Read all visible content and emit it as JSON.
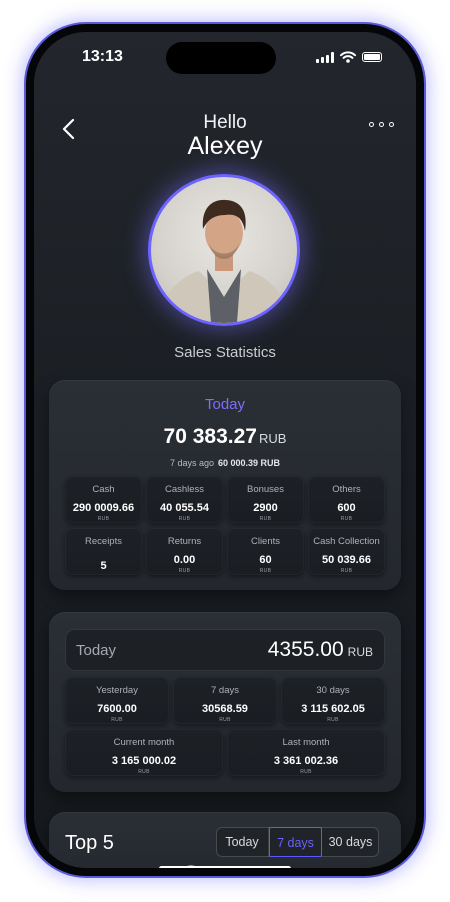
{
  "status_bar": {
    "time": "13:13"
  },
  "header": {
    "greeting": "Hello",
    "name": "Alexey"
  },
  "section_title": "Sales Statistics",
  "today_card": {
    "label": "Today",
    "total_value": "70 383.27",
    "total_currency": "RUB",
    "ago_label": "7 days ago",
    "ago_value": "60 000.39 RUB",
    "tiles": [
      {
        "label": "Cash",
        "value": "290 0009.66",
        "unit": "RUB"
      },
      {
        "label": "Cashless",
        "value": "40 055.54",
        "unit": "RUB"
      },
      {
        "label": "Bonuses",
        "value": "2900",
        "unit": "RUB"
      },
      {
        "label": "Others",
        "value": "600",
        "unit": "RUB"
      },
      {
        "label": "Receipts",
        "value": "5",
        "unit": ""
      },
      {
        "label": "Returns",
        "value": "0.00",
        "unit": "RUB"
      },
      {
        "label": "Clients",
        "value": "60",
        "unit": "RUB"
      },
      {
        "label": "Cash Collection",
        "value": "50 039.66",
        "unit": "RUB"
      }
    ]
  },
  "period_card": {
    "field_label": "Today",
    "field_value": "4355.00",
    "field_currency": "RUB",
    "tiles": [
      {
        "label": "Yesterday",
        "value": "7600.00",
        "unit": "RUB"
      },
      {
        "label": "7 days",
        "value": "30568.59",
        "unit": "RUB"
      },
      {
        "label": "30 days",
        "value": "3 115 602.05",
        "unit": "RUB"
      },
      {
        "label": "Current month",
        "value": "3 165 000.02",
        "unit": "RUB"
      },
      {
        "label": "Last month",
        "value": "3 361 002.36",
        "unit": "RUB"
      }
    ]
  },
  "top5": {
    "title": "Top 5",
    "tabs": [
      {
        "label": "Today"
      },
      {
        "label": "7 days"
      },
      {
        "label": "30 days"
      }
    ],
    "active_tab": "7 days"
  },
  "colors": {
    "accent": "#6a62ff",
    "background": "#1b1f24",
    "card": "#282c32"
  },
  "icons": [
    "back-icon",
    "more-icon",
    "signal-icon",
    "wifi-icon",
    "battery-icon"
  ]
}
